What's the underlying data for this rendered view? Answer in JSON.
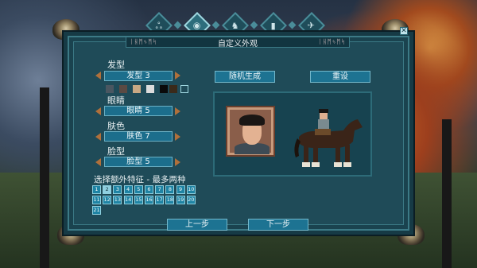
{
  "window": {
    "title": "自定义外观",
    "title_deco_left": "ᛁᚺᛗᛃᛗᛋ",
    "title_deco_right": "ᛁᚺᛗᛃᛗᛋ",
    "close_label": "✕"
  },
  "tabs": [
    {
      "name": "tab-crest",
      "icon": "crest-icon",
      "glyph": "ஃ",
      "active": false
    },
    {
      "name": "tab-appearance",
      "icon": "eye-icon",
      "glyph": "◉",
      "active": true
    },
    {
      "name": "tab-horse",
      "icon": "horse-icon",
      "glyph": "♞",
      "active": false
    },
    {
      "name": "tab-banner",
      "icon": "banner-icon",
      "glyph": "▮",
      "active": false
    },
    {
      "name": "tab-bird",
      "icon": "bird-icon",
      "glyph": "✈",
      "active": false
    }
  ],
  "hair": {
    "label": "发型",
    "value": "发型 3"
  },
  "hair_colors": [
    "#4a5761",
    "#5b4a43",
    "#c8a884",
    "#dcdcdc",
    "#0a0a0a",
    "#3a2a1a",
    "#1f4b58"
  ],
  "eyes": {
    "label": "眼睛",
    "value": "眼睛 5"
  },
  "skin": {
    "label": "肤色",
    "value": "肤色 7"
  },
  "face": {
    "label": "脸型",
    "value": "脸型 5"
  },
  "buttons": {
    "random": "随机生成",
    "reset": "重设",
    "prev": "上一步",
    "next": "下一步"
  },
  "traits": {
    "title": "选择额外特征 - 最多两种",
    "numbers": [
      "1",
      "2",
      "3",
      "4",
      "5",
      "6",
      "7",
      "8",
      "9",
      "10",
      "11",
      "12",
      "13",
      "14",
      "15",
      "16",
      "17",
      "18",
      "19",
      "20",
      "21"
    ],
    "selected": "2"
  },
  "colors": {
    "accent": "#1d7392",
    "panel": "#1f4b58",
    "arrow": "#b0703b"
  }
}
